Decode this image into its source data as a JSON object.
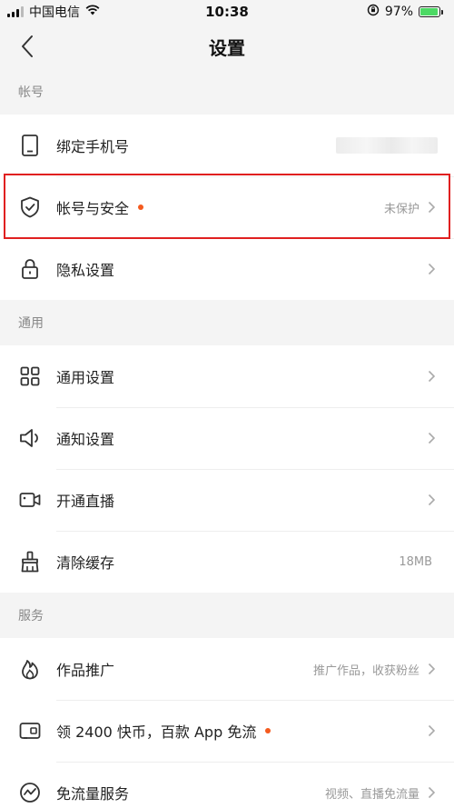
{
  "status_bar": {
    "carrier": "中国电信",
    "time": "10:38",
    "battery": "97%",
    "battery_level": 0.97
  },
  "nav": {
    "title": "设置"
  },
  "sections": [
    {
      "header": "帐号",
      "items": [
        {
          "label": "绑定手机号",
          "value": ""
        },
        {
          "label": "帐号与安全",
          "value": "未保护"
        },
        {
          "label": "隐私设置",
          "value": ""
        }
      ]
    },
    {
      "header": "通用",
      "items": [
        {
          "label": "通用设置",
          "value": ""
        },
        {
          "label": "通知设置",
          "value": ""
        },
        {
          "label": "开通直播",
          "value": ""
        },
        {
          "label": "清除缓存",
          "value": "18MB"
        }
      ]
    },
    {
      "header": "服务",
      "items": [
        {
          "label": "作品推广",
          "value": "推广作品，收获粉丝"
        },
        {
          "label": "领 2400 快币，百款 App 免流",
          "value": ""
        },
        {
          "label": "免流量服务",
          "value": "视频、直播免流量"
        }
      ]
    }
  ],
  "colors": {
    "accent_dot": "#f45a1e",
    "highlight": "#e02020"
  }
}
